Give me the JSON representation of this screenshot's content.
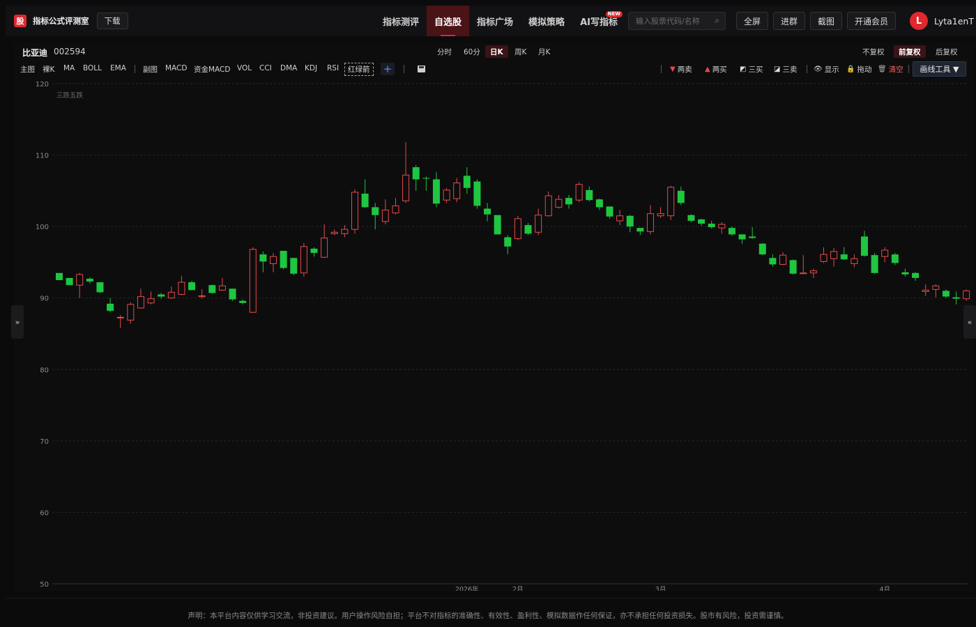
{
  "header": {
    "logo_char": "股",
    "brand": "指标公式评测室",
    "download": "下载",
    "nav": [
      "指标测评",
      "自选股",
      "指标广场",
      "模拟策略",
      "AI写指标"
    ],
    "nav_active_index": 1,
    "new_badge": "NEW",
    "search_placeholder": "输入股票代码/名称",
    "fullscreen": "全屏",
    "join_group": "进群",
    "screenshot": "截图",
    "vip": "开通会员",
    "avatar_letter": "L",
    "username": "Lyta1enT"
  },
  "stock": {
    "name": "比亚迪",
    "code": "002594"
  },
  "periods": [
    "分时",
    "60分",
    "日K",
    "周K",
    "月K"
  ],
  "period_active_index": 2,
  "adjust": [
    "不复权",
    "前复权",
    "后复权"
  ],
  "adjust_active_index": 1,
  "indicators_main": [
    "主图",
    "裸K",
    "MA",
    "BOLL",
    "EMA"
  ],
  "indicators_sub": [
    "副图",
    "MACD",
    "资金MACD",
    "VOL",
    "CCI",
    "DMA",
    "KDJ",
    "RSI"
  ],
  "indicator_custom": "红绿箭",
  "tools": {
    "two_sell": "两卖",
    "two_buy": "两买",
    "three_buy": "三买",
    "three_sell": "三卖",
    "show": "显示",
    "drag": "拖动",
    "clear": "清空",
    "draw_tools": "画线工具 ▼"
  },
  "colors": {
    "up": "#e84a4a",
    "down": "#1fc640",
    "accent": "#e0282e",
    "clear": "#ff5a5a"
  },
  "chart_data": {
    "type": "candlestick",
    "annotation": "三跌五跌",
    "ylim": [
      50,
      120
    ],
    "yticks": [
      120,
      110,
      100,
      90,
      80,
      70,
      60,
      50
    ],
    "x_labels": [
      {
        "index": 40,
        "label": "2026年"
      },
      {
        "index": 45,
        "label": "2月"
      },
      {
        "index": 59,
        "label": "3月"
      },
      {
        "index": 81,
        "label": "4月"
      }
    ],
    "candles": [
      [
        93.5,
        92.5,
        93.5,
        92.5
      ],
      [
        92.8,
        91.8,
        92.8,
        91.8
      ],
      [
        91.8,
        93.3,
        93.5,
        90.0
      ],
      [
        92.7,
        92.3,
        92.9,
        92.0
      ],
      [
        92.2,
        90.8,
        92.2,
        90.7
      ],
      [
        89.2,
        88.2,
        90.0,
        88.0
      ],
      [
        87.2,
        87.3,
        87.6,
        85.8
      ],
      [
        86.9,
        89.1,
        89.4,
        86.4
      ],
      [
        88.6,
        90.2,
        91.3,
        88.5
      ],
      [
        89.3,
        89.9,
        90.9,
        89.1
      ],
      [
        90.5,
        90.2,
        90.7,
        89.9
      ],
      [
        90.0,
        90.8,
        91.6,
        89.9
      ],
      [
        90.5,
        92.2,
        93.1,
        90.4
      ],
      [
        92.2,
        91.1,
        92.4,
        91.1
      ],
      [
        90.2,
        90.3,
        91.2,
        89.9
      ],
      [
        91.8,
        90.7,
        91.9,
        90.6
      ],
      [
        91.1,
        91.7,
        92.8,
        91.0
      ],
      [
        91.3,
        89.8,
        91.3,
        89.6
      ],
      [
        89.6,
        89.3,
        89.8,
        89.1
      ],
      [
        88.0,
        96.8,
        97.1,
        87.9
      ],
      [
        96.1,
        95.1,
        96.5,
        93.6
      ],
      [
        94.8,
        95.8,
        96.3,
        93.6
      ],
      [
        96.6,
        94.2,
        96.6,
        94.0
      ],
      [
        95.6,
        93.4,
        95.6,
        93.2
      ],
      [
        93.5,
        97.2,
        97.7,
        93.0
      ],
      [
        96.9,
        96.3,
        97.1,
        95.8
      ],
      [
        95.7,
        98.4,
        100.3,
        95.6
      ],
      [
        99.0,
        99.2,
        99.6,
        98.8
      ],
      [
        99.0,
        99.6,
        100.2,
        98.5
      ],
      [
        99.6,
        104.8,
        105.2,
        99.0
      ],
      [
        104.6,
        102.7,
        106.6,
        102.6
      ],
      [
        102.7,
        101.6,
        103.3,
        99.6
      ],
      [
        100.7,
        102.3,
        103.8,
        100.3
      ],
      [
        101.9,
        102.9,
        104.0,
        101.7
      ],
      [
        103.6,
        107.2,
        111.8,
        103.3
      ],
      [
        108.3,
        106.6,
        108.6,
        105.0
      ],
      [
        106.8,
        106.7,
        107.0,
        105.0
      ],
      [
        106.6,
        103.2,
        107.6,
        102.7
      ],
      [
        103.7,
        105.1,
        105.4,
        103.3
      ],
      [
        103.9,
        106.1,
        106.8,
        103.4
      ],
      [
        107.1,
        105.4,
        108.3,
        104.6
      ],
      [
        106.3,
        102.9,
        106.6,
        102.5
      ],
      [
        102.5,
        101.7,
        103.3,
        100.7
      ],
      [
        101.6,
        98.9,
        101.6,
        98.9
      ],
      [
        98.5,
        97.2,
        98.8,
        96.1
      ],
      [
        98.3,
        101.1,
        101.5,
        98.1
      ],
      [
        100.2,
        99.0,
        100.5,
        98.8
      ],
      [
        99.2,
        101.6,
        102.5,
        98.8
      ],
      [
        101.5,
        104.3,
        104.9,
        101.4
      ],
      [
        102.7,
        103.8,
        104.4,
        102.5
      ],
      [
        104.0,
        103.1,
        104.4,
        102.5
      ],
      [
        103.7,
        105.9,
        106.2,
        103.4
      ],
      [
        105.1,
        103.7,
        105.6,
        103.5
      ],
      [
        103.8,
        102.7,
        103.9,
        102.3
      ],
      [
        102.8,
        101.4,
        102.8,
        101.1
      ],
      [
        100.8,
        101.5,
        102.3,
        100.2
      ],
      [
        101.5,
        100.0,
        101.6,
        99.2
      ],
      [
        99.8,
        99.3,
        99.8,
        98.8
      ],
      [
        99.3,
        101.8,
        103.0,
        98.9
      ],
      [
        101.5,
        101.8,
        102.7,
        101.2
      ],
      [
        101.5,
        105.5,
        105.7,
        100.9
      ],
      [
        105.0,
        103.3,
        105.6,
        103.0
      ],
      [
        101.6,
        100.8,
        101.7,
        100.6
      ],
      [
        101.0,
        100.4,
        101.1,
        100.1
      ],
      [
        100.4,
        99.9,
        100.8,
        99.7
      ],
      [
        99.8,
        100.3,
        100.6,
        99.0
      ],
      [
        99.8,
        98.9,
        100.0,
        98.7
      ],
      [
        98.9,
        98.2,
        98.9,
        97.6
      ],
      [
        98.6,
        98.4,
        99.9,
        98.3
      ],
      [
        97.6,
        96.1,
        97.7,
        96.0
      ],
      [
        95.6,
        94.7,
        96.1,
        94.4
      ],
      [
        94.7,
        96.0,
        96.4,
        94.6
      ],
      [
        95.3,
        93.4,
        95.4,
        93.3
      ],
      [
        93.5,
        93.5,
        96.0,
        93.4
      ],
      [
        93.5,
        93.8,
        94.1,
        92.8
      ],
      [
        95.1,
        96.1,
        97.1,
        94.9
      ],
      [
        95.5,
        96.5,
        97.0,
        94.4
      ],
      [
        96.1,
        95.4,
        97.1,
        95.3
      ],
      [
        94.8,
        95.5,
        96.1,
        94.3
      ],
      [
        98.6,
        95.9,
        99.4,
        95.8
      ],
      [
        96.0,
        93.5,
        96.3,
        93.4
      ],
      [
        95.8,
        96.7,
        97.1,
        95.0
      ],
      [
        96.1,
        94.9,
        96.3,
        94.6
      ],
      [
        93.6,
        93.3,
        94.1,
        93.0
      ],
      [
        93.5,
        92.8,
        93.6,
        92.4
      ],
      [
        90.9,
        91.1,
        91.9,
        90.3
      ],
      [
        91.2,
        91.7,
        91.9,
        90.1
      ],
      [
        91.0,
        90.2,
        91.2,
        90.0
      ],
      [
        90.1,
        89.9,
        90.9,
        89.1
      ],
      [
        89.9,
        91.0,
        91.2,
        89.6
      ]
    ]
  },
  "disclaimer": "声明：本平台内容仅供学习交流，非投资建议。用户操作风险自担；平台不对指标的准确性、有效性、盈利性、模拟数据作任何保证，亦不承担任何投资损失。股市有风险，投资需谨慎。",
  "toggles": {
    "left": "»",
    "right": "«"
  }
}
